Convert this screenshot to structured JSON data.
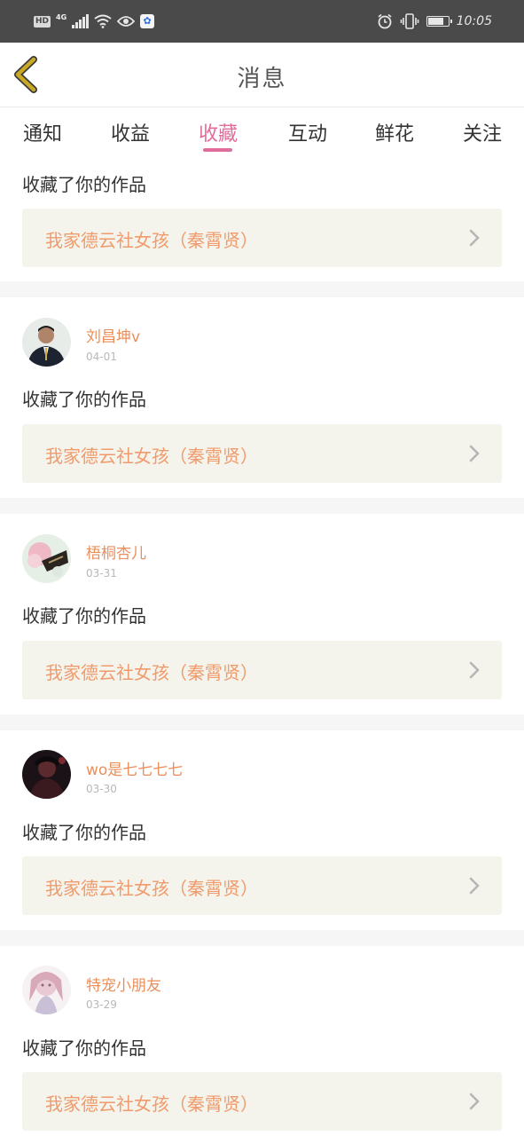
{
  "status_bar": {
    "hd": "HD",
    "network": "4G",
    "time": "10:05",
    "battery_level": 0.85,
    "icons": [
      "hd-icon",
      "signal-icon",
      "wifi-icon",
      "eye-icon",
      "baidu-icon",
      "alarm-icon",
      "vibrate-icon",
      "battery-icon"
    ]
  },
  "header": {
    "title": "消息",
    "back_icon": "chevron-left-icon",
    "back_color": "#c9a825"
  },
  "tabs": [
    {
      "label": "通知"
    },
    {
      "label": "收益"
    },
    {
      "label": "收藏"
    },
    {
      "label": "互动"
    },
    {
      "label": "鲜花"
    },
    {
      "label": "关注"
    }
  ],
  "active_tab": "收藏",
  "colors": {
    "accent": "#e06d9b",
    "name": "#ea8f5b",
    "link_bg": "#f4f4ec",
    "link_text": "#ef9b6d"
  },
  "messages": [
    {
      "text": "收藏了你的作品",
      "work_title": "我家德云社女孩（秦霄贤）"
    },
    {
      "name": "刘昌坤v",
      "date": "04-01",
      "text": "收藏了你的作品",
      "work_title": "我家德云社女孩（秦霄贤）"
    },
    {
      "name": "梧桐杏儿",
      "date": "03-31",
      "text": "收藏了你的作品",
      "work_title": "我家德云社女孩（秦霄贤）"
    },
    {
      "name": "wo是七七七七",
      "date": "03-30",
      "text": "收藏了你的作品",
      "work_title": "我家德云社女孩（秦霄贤）"
    },
    {
      "name": "特宠小朋友",
      "date": "03-29",
      "text": "收藏了你的作品",
      "work_title": "我家德云社女孩（秦霄贤）"
    }
  ]
}
